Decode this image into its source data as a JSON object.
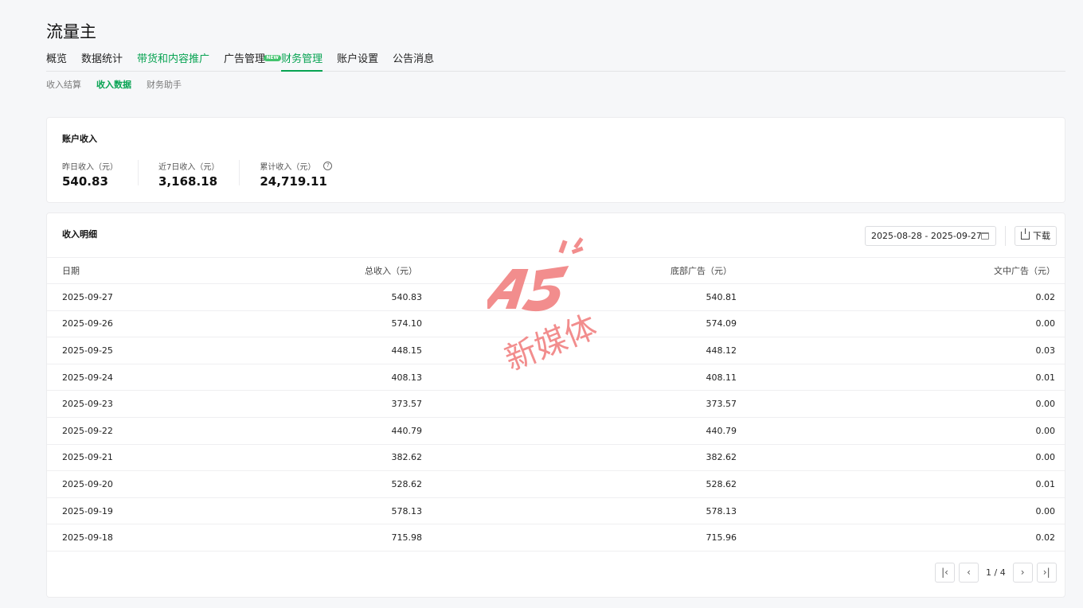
{
  "app": {
    "title": "流量主"
  },
  "main_nav": {
    "tabs": [
      {
        "label": "概览"
      },
      {
        "label": "数据统计"
      },
      {
        "label": "带货和内容推广"
      },
      {
        "label": "广告管理",
        "badge": "NEW"
      },
      {
        "label": "财务管理",
        "active": true
      },
      {
        "label": "账户设置"
      },
      {
        "label": "公告消息"
      }
    ]
  },
  "sub_nav": {
    "items": [
      {
        "label": "收入结算"
      },
      {
        "label": "收入数据",
        "active": true
      },
      {
        "label": "财务助手"
      }
    ]
  },
  "summary": {
    "title": "账户收入",
    "metrics": [
      {
        "label": "昨日收入（元）",
        "value": "540.83"
      },
      {
        "label": "近7日收入（元）",
        "value": "3,168.18"
      },
      {
        "label": "累计收入（元）",
        "value": "24,719.11",
        "help_icon": "question-circle-icon"
      }
    ]
  },
  "detail": {
    "title": "收入明细",
    "date_range": "2025-08-28 - 2025-09-27",
    "download_label": "下载",
    "columns": [
      "日期",
      "总收入（元）",
      "底部广告（元）",
      "文中广告（元）"
    ],
    "rows": [
      [
        "2025-09-27",
        "540.83",
        "540.81",
        "0.02"
      ],
      [
        "2025-09-26",
        "574.10",
        "574.09",
        "0.00"
      ],
      [
        "2025-09-25",
        "448.15",
        "448.12",
        "0.03"
      ],
      [
        "2025-09-24",
        "408.13",
        "408.11",
        "0.01"
      ],
      [
        "2025-09-23",
        "373.57",
        "373.57",
        "0.00"
      ],
      [
        "2025-09-22",
        "440.79",
        "440.79",
        "0.00"
      ],
      [
        "2025-09-21",
        "382.62",
        "382.62",
        "0.00"
      ],
      [
        "2025-09-20",
        "528.62",
        "528.62",
        "0.01"
      ],
      [
        "2025-09-19",
        "578.13",
        "578.13",
        "0.00"
      ],
      [
        "2025-09-18",
        "715.98",
        "715.96",
        "0.02"
      ]
    ],
    "pagination": {
      "indicator": "1 / 4"
    }
  },
  "watermark": {
    "text": "A5",
    "subtext": "新媒体",
    "color": "#f07a7a"
  },
  "colors": {
    "accent": "#07a352",
    "badge": "#43c36e"
  }
}
